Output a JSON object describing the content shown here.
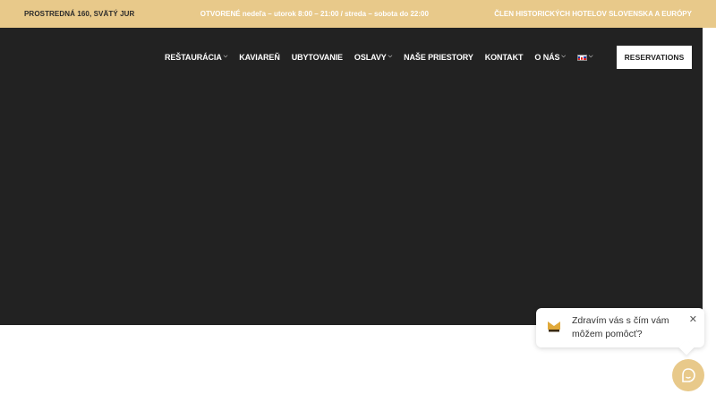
{
  "topbar": {
    "address": "PROSTREDNÁ 160, SVÄTÝ JUR",
    "hours": "OTVORENÉ nedeľa – utorok 8:00 – 21:00 / streda – sobota do 22:00",
    "member": "ČLEN HISTORICKÝCH HOTELOV SLOVENSKA A EURÓPY"
  },
  "nav": {
    "items": [
      {
        "label": "REŠTAURÁCIA",
        "has_dropdown": true
      },
      {
        "label": "KAVIAREŇ",
        "has_dropdown": false
      },
      {
        "label": "UBYTOVANIE",
        "has_dropdown": false
      },
      {
        "label": "OSLAVY",
        "has_dropdown": true
      },
      {
        "label": "NAŠE PRIESTORY",
        "has_dropdown": false
      },
      {
        "label": "KONTAKT",
        "has_dropdown": false
      },
      {
        "label": "O NÁS",
        "has_dropdown": true
      }
    ],
    "language_flag": "slovak-flag-icon",
    "reserve_label": "RESERVATIONS"
  },
  "chat": {
    "message": "Zdravím vás s čím vám môžem pomôcť?",
    "close_icon": "close-icon",
    "launcher_icon": "chat-icon"
  },
  "colors": {
    "accent": "#e8c98a",
    "hero_bg": "#222222",
    "text_dark": "#2a2a2a"
  }
}
